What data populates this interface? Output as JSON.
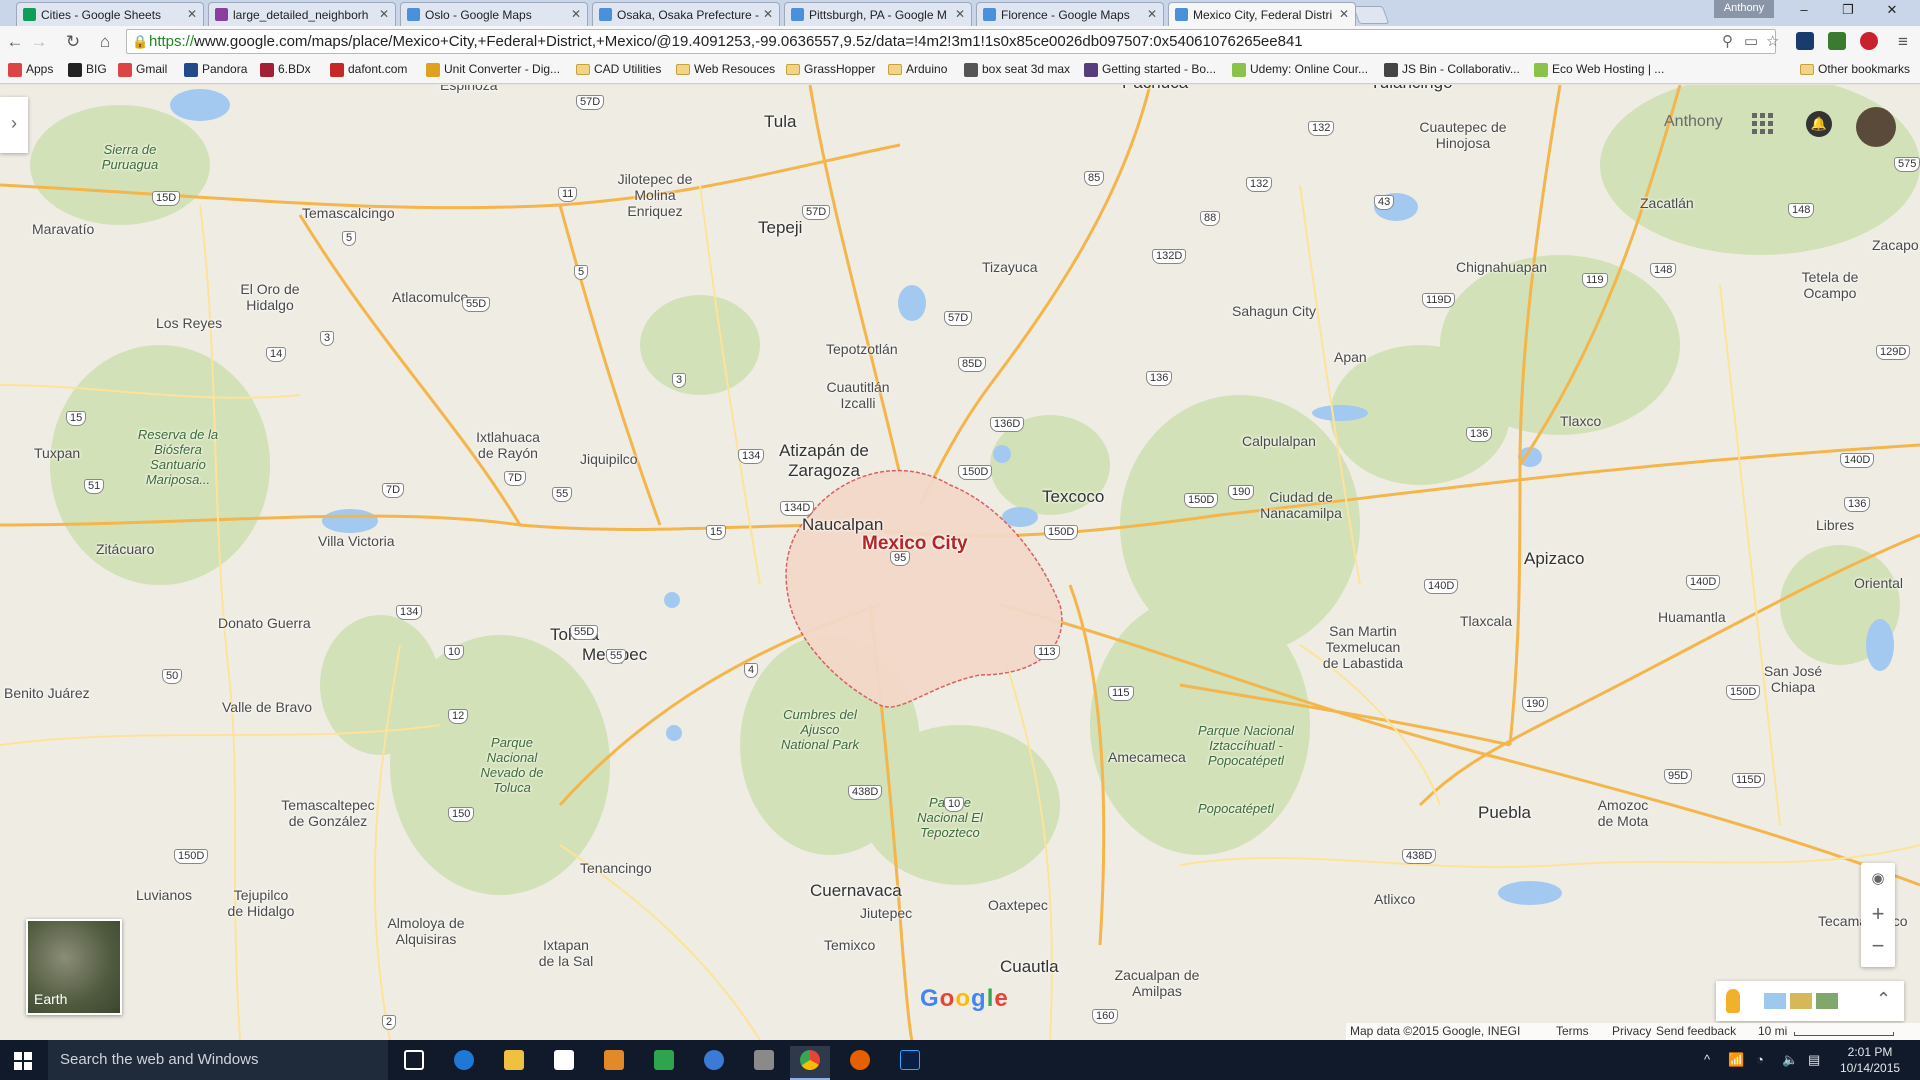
{
  "tabs": [
    {
      "label": "Cities - Google Sheets",
      "color": "#0f9d58"
    },
    {
      "label": "large_detailed_neighborh",
      "color": "#8a3e9e"
    },
    {
      "label": "Oslo - Google Maps",
      "color": "#4a90d9"
    },
    {
      "label": "Osaka, Osaka Prefecture -",
      "color": "#4a90d9"
    },
    {
      "label": "Pittsburgh, PA - Google M",
      "color": "#4a90d9"
    },
    {
      "label": "Florence - Google Maps",
      "color": "#4a90d9"
    },
    {
      "label": "Mexico City, Federal Distri",
      "color": "#4a90d9"
    }
  ],
  "window": {
    "user": "Anthony",
    "minimize": "–",
    "restore": "❐",
    "close": "✕"
  },
  "toolbar": {
    "back": "←",
    "forward": "→",
    "reload": "↻",
    "home": "⌂",
    "url_scheme": "https://",
    "url_rest": "www.google.com/maps/place/Mexico+City,+Federal+District,+Mexico/@19.4091253,-99.0636557,9.5z/data=!4m2!3m1!1s0x85ce0026db097507:0x54061076265ee841",
    "menu": "≡"
  },
  "bookmarks": [
    {
      "label": "Apps",
      "color": "#d44"
    },
    {
      "label": "BIG",
      "color": "#222"
    },
    {
      "label": "Gmail",
      "color": "#d44"
    },
    {
      "label": "Pandora",
      "color": "#224a8a"
    },
    {
      "label": "6.BDx",
      "color": "#a31f34"
    },
    {
      "label": "dafont.com",
      "color": "#c62828"
    },
    {
      "label": "Unit Converter - Dig...",
      "color": "#e0a020"
    },
    {
      "label": "CAD Utilities",
      "color": "folder"
    },
    {
      "label": "Web Resouces",
      "color": "folder"
    },
    {
      "label": "GrassHopper",
      "color": "folder"
    },
    {
      "label": "Arduino",
      "color": "folder"
    },
    {
      "label": "box seat 3d max",
      "color": "#555"
    },
    {
      "label": "Getting started - Bo...",
      "color": "#563d7c"
    },
    {
      "label": "Udemy: Online Cour...",
      "color": "#8bc34a"
    },
    {
      "label": "JS Bin - Collaborativ...",
      "color": "#444"
    },
    {
      "label": "Eco Web Hosting | ...",
      "color": "#8bc34a"
    },
    {
      "label": "Other bookmarks",
      "color": "folder"
    }
  ],
  "map": {
    "account_name": "Anthony",
    "earth_label": "Earth",
    "logo": "Google",
    "zoom_in": "+",
    "zoom_out": "−",
    "places": [
      {
        "name": "Pachuca",
        "cls": ""
      },
      {
        "name": "Tulancingo",
        "cls": "big"
      },
      {
        "name": "Espinoza",
        "cls": ""
      },
      {
        "name": "Tula",
        "cls": "big"
      },
      {
        "name": "Cuautepec de Hinojosa",
        "cls": ""
      },
      {
        "name": "Sierra de Puruagua",
        "cls": "park"
      },
      {
        "name": "Jilotepec de Molina Enriquez",
        "cls": ""
      },
      {
        "name": "Zacatlán",
        "cls": ""
      },
      {
        "name": "Maravatío",
        "cls": ""
      },
      {
        "name": "Temascalcingo",
        "cls": ""
      },
      {
        "name": "Tepeji",
        "cls": ""
      },
      {
        "name": "Tizayuca",
        "cls": ""
      },
      {
        "name": "Chignahuapan",
        "cls": ""
      },
      {
        "name": "Tetela de Ocampo",
        "cls": ""
      },
      {
        "name": "El Oro de Hidalgo",
        "cls": ""
      },
      {
        "name": "Atlacomulco",
        "cls": ""
      },
      {
        "name": "Sahagun City",
        "cls": ""
      },
      {
        "name": "Los Reyes",
        "cls": ""
      },
      {
        "name": "Tepotzotlán",
        "cls": ""
      },
      {
        "name": "Apan",
        "cls": ""
      },
      {
        "name": "Cuautitlán Izcalli",
        "cls": ""
      },
      {
        "name": "Reserva de la Biósfera Santuario Mariposa...",
        "cls": "park"
      },
      {
        "name": "Ixtlahuaca de Rayón",
        "cls": ""
      },
      {
        "name": "Calpulalpan",
        "cls": ""
      },
      {
        "name": "Tlaxco",
        "cls": ""
      },
      {
        "name": "Tuxpan",
        "cls": ""
      },
      {
        "name": "Jiquipilco",
        "cls": ""
      },
      {
        "name": "Atizapán de Zaragoza",
        "cls": "big"
      },
      {
        "name": "Texcoco",
        "cls": "big"
      },
      {
        "name": "Ciudad de Nanacamilpa",
        "cls": ""
      },
      {
        "name": "Naucalpan",
        "cls": "big"
      },
      {
        "name": "Mexico City",
        "cls": "capital"
      },
      {
        "name": "Libres",
        "cls": ""
      },
      {
        "name": "Zitácuaro",
        "cls": ""
      },
      {
        "name": "Villa Victoria",
        "cls": ""
      },
      {
        "name": "Apizaco",
        "cls": "big"
      },
      {
        "name": "Oriental",
        "cls": ""
      },
      {
        "name": "Donato Guerra",
        "cls": ""
      },
      {
        "name": "Toluca",
        "cls": "big"
      },
      {
        "name": "Metepec",
        "cls": "big"
      },
      {
        "name": "San Martin Texmelucan de Labastida",
        "cls": ""
      },
      {
        "name": "Tlaxcala",
        "cls": ""
      },
      {
        "name": "Huamantla",
        "cls": ""
      },
      {
        "name": "San José Chiapa",
        "cls": ""
      },
      {
        "name": "Benito Juárez",
        "cls": ""
      },
      {
        "name": "Valle de Bravo",
        "cls": ""
      },
      {
        "name": "Cumbres del Ajusco National Park",
        "cls": "park"
      },
      {
        "name": "Parque Nacional Nevado de Toluca",
        "cls": "park"
      },
      {
        "name": "Parque Nacional Iztaccíhuatl - Popocatépetl",
        "cls": "park"
      },
      {
        "name": "Amecameca",
        "cls": ""
      },
      {
        "name": "Temascaltepec de González",
        "cls": ""
      },
      {
        "name": "Popocatépetl",
        "cls": "park"
      },
      {
        "name": "Parque Nacional El Tepozteco",
        "cls": "park"
      },
      {
        "name": "Puebla",
        "cls": "big"
      },
      {
        "name": "Amozoc de Mota",
        "cls": ""
      },
      {
        "name": "Tenancingo",
        "cls": ""
      },
      {
        "name": "Luvianos",
        "cls": ""
      },
      {
        "name": "Tejupilco de Hidalgo",
        "cls": ""
      },
      {
        "name": "Cuernavaca",
        "cls": "big"
      },
      {
        "name": "Jiutepec",
        "cls": ""
      },
      {
        "name": "Atlixco",
        "cls": ""
      },
      {
        "name": "Oaxtepec",
        "cls": ""
      },
      {
        "name": "Tecamachalco",
        "cls": ""
      },
      {
        "name": "Almoloya de Alquisiras",
        "cls": ""
      },
      {
        "name": "Ixtapan de la Sal",
        "cls": ""
      },
      {
        "name": "Temixco",
        "cls": ""
      },
      {
        "name": "Cuautla",
        "cls": "big"
      },
      {
        "name": "Zacualpan de Amilpas",
        "cls": ""
      },
      {
        "name": "Zacapo",
        "cls": ""
      }
    ],
    "shields": [
      "57D",
      "85",
      "88",
      "132",
      "132",
      "43",
      "575",
      "148",
      "15D",
      "11",
      "57D",
      "132D",
      "119D",
      "119",
      "148",
      "5",
      "55D",
      "5",
      "57D",
      "129D",
      "14",
      "3",
      "85D",
      "136",
      "3",
      "136D",
      "15",
      "150D",
      "134",
      "150D",
      "190",
      "136",
      "140D",
      "140D",
      "136",
      "51",
      "7D",
      "7D",
      "55",
      "134D",
      "15",
      "150D",
      "95",
      "140D",
      "55D",
      "134",
      "55",
      "4",
      "113",
      "150D",
      "10",
      "50",
      "115",
      "190",
      "12",
      "95D",
      "115D",
      "438D",
      "150",
      "150D",
      "2",
      "438D",
      "10",
      "160"
    ],
    "footer": {
      "data": "Map data ©2015 Google, INEGI",
      "terms": "Terms",
      "privacy": "Privacy",
      "feedback": "Send feedback",
      "scale": "10 mi"
    }
  },
  "taskbar": {
    "search_placeholder": "Search the web and Windows",
    "time": "2:01 PM",
    "date": "10/14/2015",
    "tray_chevron": "^"
  }
}
